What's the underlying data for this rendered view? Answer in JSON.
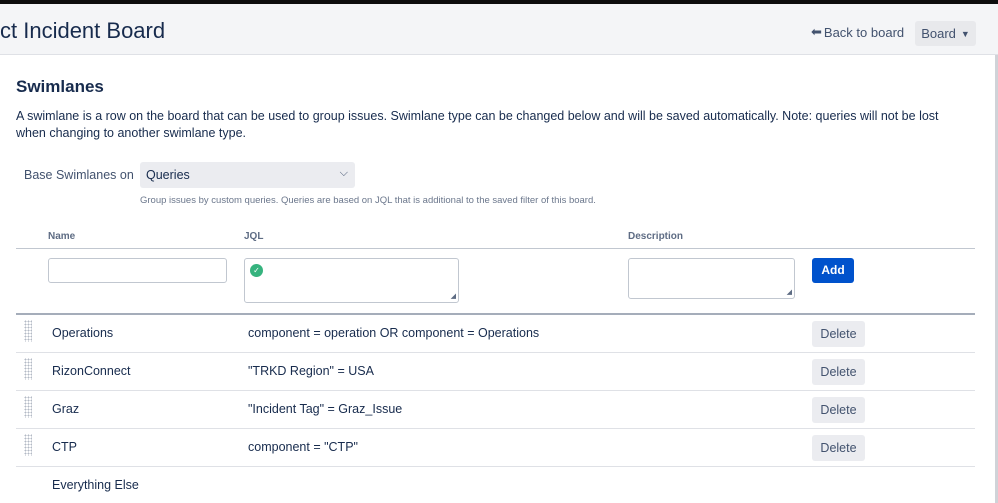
{
  "header": {
    "title": "ct Incident Board",
    "back_label": "Back to board",
    "board_label": "Board"
  },
  "section": {
    "title": "Swimlanes",
    "intro": "A swimlane is a row on the board that can be used to group issues. Swimlane type can be changed below and will be saved automatically. Note: queries will not be lost when changing to another swimlane type."
  },
  "base": {
    "label": "Base Swimlanes on",
    "selected": "Queries",
    "help": "Group issues by custom queries. Queries are based on JQL that is additional to the saved filter of this board."
  },
  "table": {
    "columns": [
      "Name",
      "JQL",
      "Description"
    ],
    "add_label": "Add",
    "delete_label": "Delete",
    "rows": [
      {
        "name": "Operations",
        "jql": "component = operation OR component = Operations"
      },
      {
        "name": "RizonConnect",
        "jql": "\"TRKD Region\" = USA"
      },
      {
        "name": "Graz",
        "jql": "\"Incident Tag\" = Graz_Issue"
      },
      {
        "name": "CTP",
        "jql": "component = \"CTP\""
      }
    ],
    "everything_else": "Everything Else"
  },
  "colors": {
    "primary": "#0052cc",
    "valid": "#36b37e",
    "header_bg": "#f4f5f7"
  },
  "icons": {
    "back": "left-arrow-icon",
    "dropdown": "chevron-down-icon",
    "valid": "check-circle-icon",
    "drag": "drag-handle-icon"
  }
}
